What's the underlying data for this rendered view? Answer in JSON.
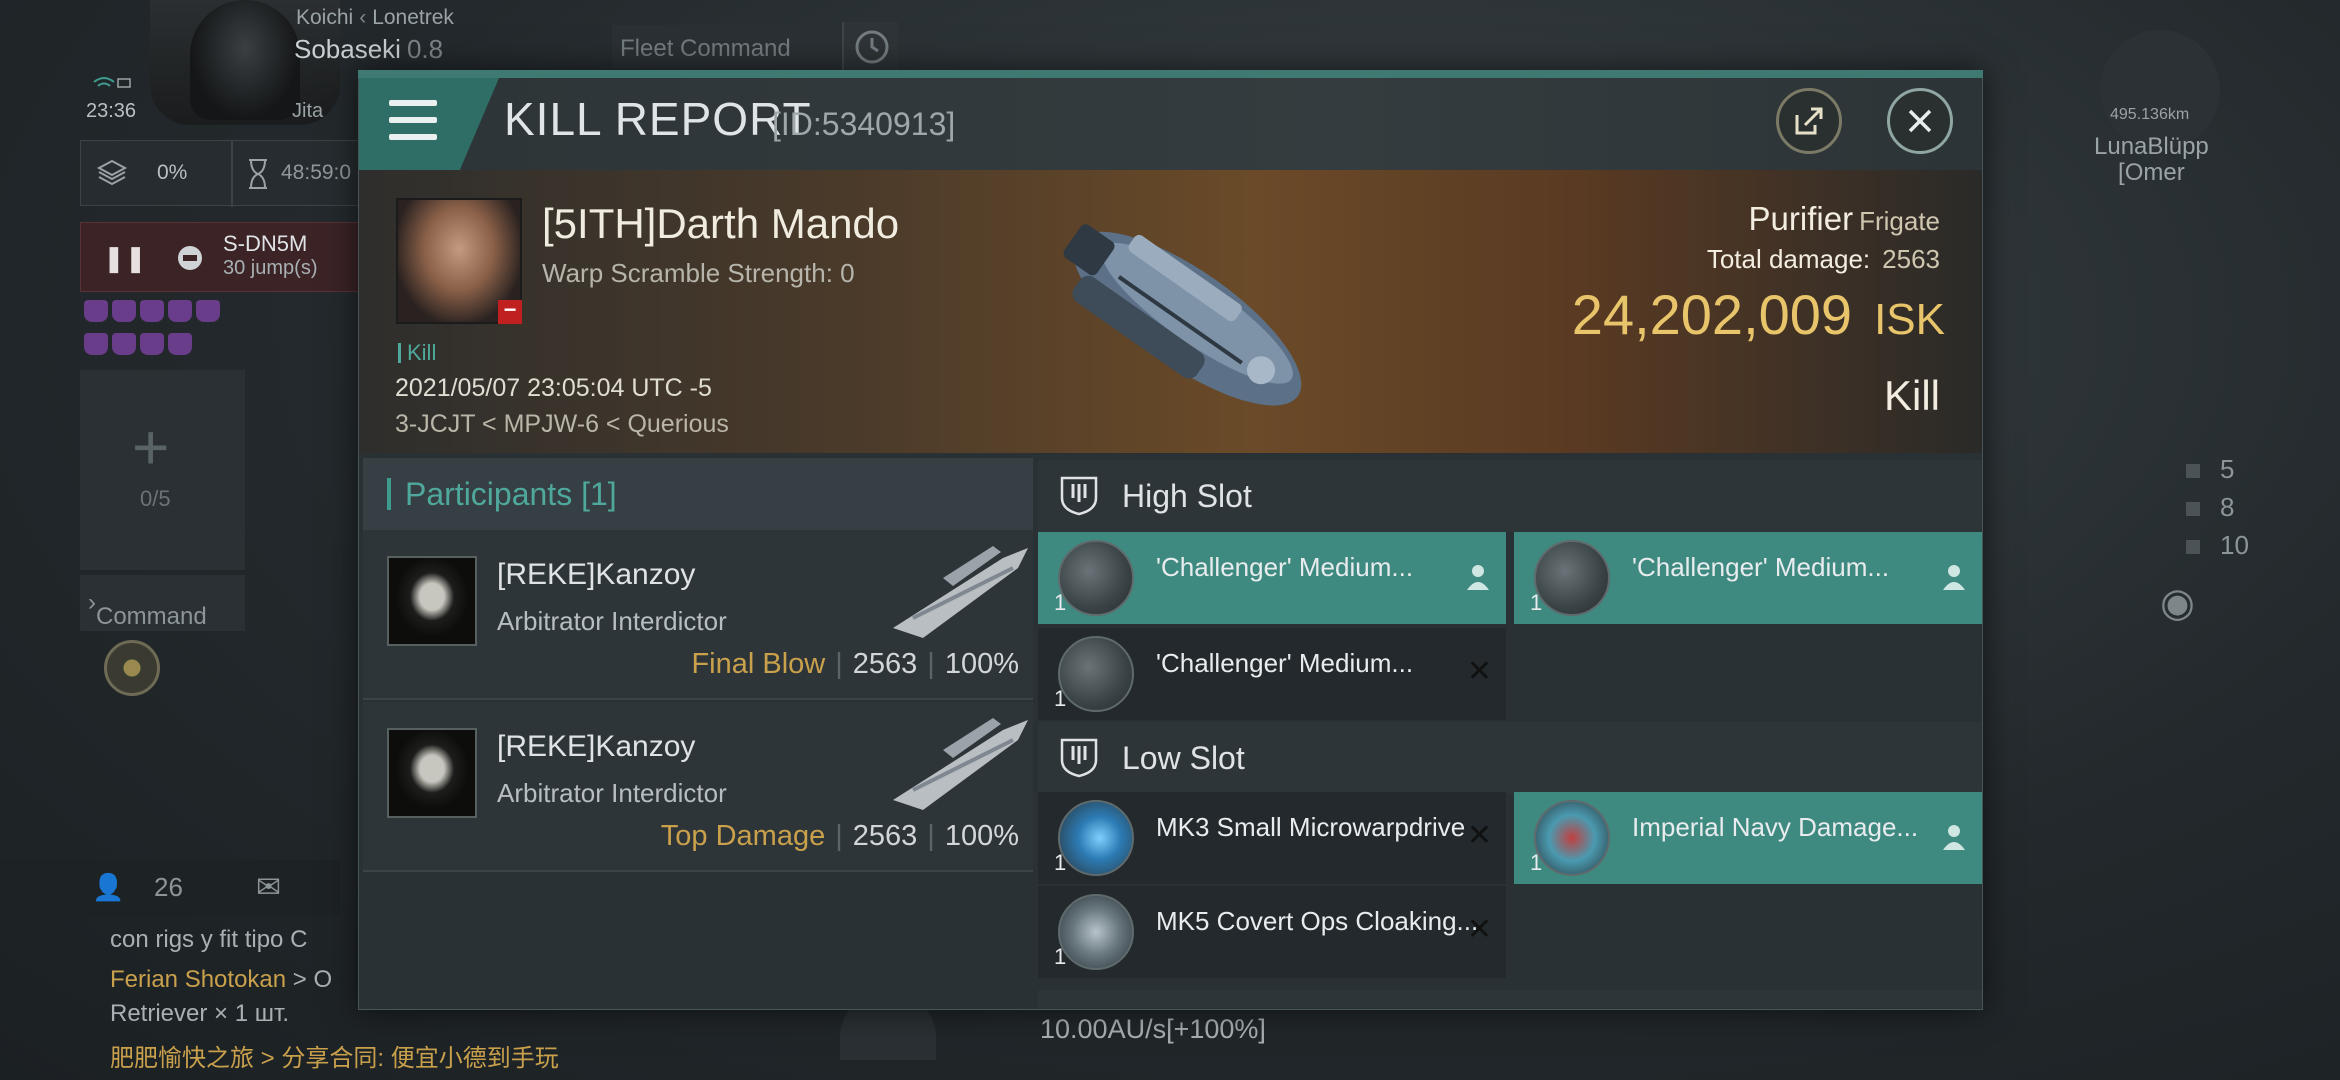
{
  "hud": {
    "corp_line": "Koichi",
    "alliance": "Lonetrek",
    "pilot_name": "Sobaseki",
    "security": "0.8",
    "time": "23:36",
    "system": "Jita",
    "cargo_pct": "0%",
    "timer": "48:59:0",
    "destination": "S-DN5M",
    "jumps": "30 jump(s)",
    "fleet_count": "0/5",
    "command_label": "Command",
    "fleet_command": "Fleet Command",
    "right_distance": "495.136km",
    "right_name_line1": "LunaBlüpp",
    "right_name_line2": "[Omer",
    "right_stats": [
      "5",
      "8",
      "10"
    ],
    "user_count": "26",
    "speed": "10.00AU/s[+100%]"
  },
  "chat": [
    {
      "name": "",
      "text": "con rigs y fit tipo C"
    },
    {
      "name": "Ferian Shotokan",
      "text": "> O"
    },
    {
      "name": "",
      "text": "Retriever × 1 шт."
    },
    {
      "name": "肥肥愉快之旅",
      "text": "> 分享合同: 便宜小德到手玩"
    }
  ],
  "report": {
    "title": "KILL REPORT",
    "id": "[ID:5340913]",
    "victim_name": "[5ITH]Darth Mando",
    "warp_scramble": "Warp Scramble Strength: 0",
    "kill_tag": "Kill",
    "datetime": "2021/05/07 23:05:04 UTC -5",
    "route": "3-JCJT < MPJW-6 < Querious",
    "ship_name": "Purifier",
    "ship_class": "Frigate",
    "total_damage_label": "Total damage:",
    "total_damage": "2563",
    "isk_value": "24,202,009",
    "isk_unit": "ISK",
    "kill_label": "Kill"
  },
  "participants": {
    "label": "Participants",
    "count": "[1]",
    "rows": [
      {
        "name": "[REKE]Kanzoy",
        "ship": "Arbitrator Interdictor",
        "tag": "Final Blow",
        "damage": "2563",
        "percent": "100%"
      },
      {
        "name": "[REKE]Kanzoy",
        "ship": "Arbitrator Interdictor",
        "tag": "Top Damage",
        "damage": "2563",
        "percent": "100%"
      }
    ]
  },
  "slots": {
    "high_label": "High Slot",
    "low_label": "Low Slot",
    "high": [
      {
        "name": "'Challenger' Medium...",
        "qty": "1",
        "status": "dropped"
      },
      {
        "name": "'Challenger' Medium...",
        "qty": "1",
        "status": "dropped"
      },
      {
        "name": "'Challenger' Medium...",
        "qty": "1",
        "status": "destroyed"
      }
    ],
    "low": [
      {
        "name": "MK3 Small Microwarpdrive",
        "qty": "1",
        "status": "destroyed"
      },
      {
        "name": "Imperial Navy Damage...",
        "qty": "1",
        "status": "dropped"
      },
      {
        "name": "MK5 Covert Ops Cloaking...",
        "qty": "1",
        "status": "destroyed"
      }
    ]
  }
}
